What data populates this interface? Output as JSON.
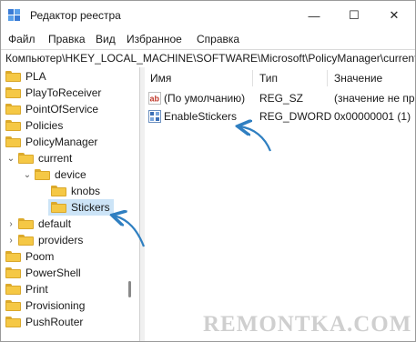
{
  "window": {
    "title": "Редактор реестра"
  },
  "controls": {
    "minimize": "—",
    "maximize": "☐",
    "close": "✕"
  },
  "menu": [
    "Файл",
    "Правка",
    "Вид",
    "Избранное",
    "Справка"
  ],
  "address": "Компьютер\\HKEY_LOCAL_MACHINE\\SOFTWARE\\Microsoft\\PolicyManager\\current",
  "tree": [
    {
      "label": "PLA"
    },
    {
      "label": "PlayToReceiver"
    },
    {
      "label": "PointOfService"
    },
    {
      "label": "Policies"
    },
    {
      "label": "PolicyManager"
    },
    {
      "label": "current"
    },
    {
      "label": "device"
    },
    {
      "label": "knobs"
    },
    {
      "label": "Stickers"
    },
    {
      "label": "default"
    },
    {
      "label": "providers"
    },
    {
      "label": "Poom"
    },
    {
      "label": "PowerShell"
    },
    {
      "label": "Print"
    },
    {
      "label": "Provisioning"
    },
    {
      "label": "PushRouter"
    }
  ],
  "columns": {
    "name": "Имя",
    "type": "Тип",
    "value": "Значение"
  },
  "values": [
    {
      "name": "(По умолчанию)",
      "type": "REG_SZ",
      "data": "(значение не пр",
      "icon": "string-value-icon"
    },
    {
      "name": "EnableStickers",
      "type": "REG_DWORD",
      "data": "0x00000001 (1)",
      "icon": "binary-value-icon"
    }
  ],
  "watermark": "REMONTKA.COM",
  "colors": {
    "arrow": "#2f7fc1",
    "folder": "#f5c845",
    "selection": "#cce4f7"
  }
}
